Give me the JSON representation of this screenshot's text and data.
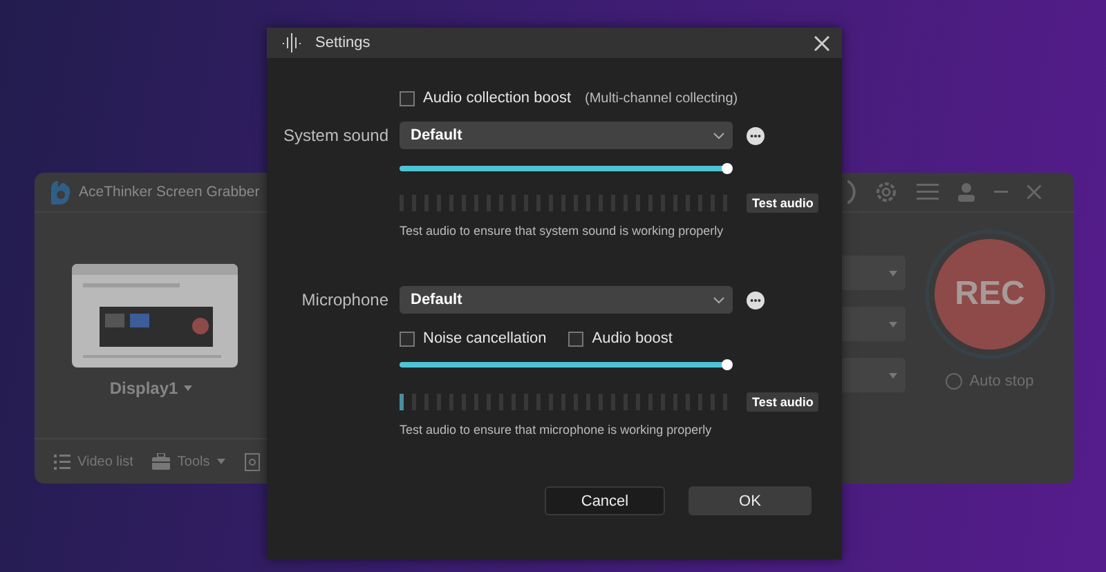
{
  "background_window": {
    "title": "AceThinker Screen Grabber",
    "display": {
      "label": "Display1"
    },
    "toolbar": [
      {
        "kind": "list",
        "label": "Video list"
      },
      {
        "kind": "tools",
        "label": "Tools"
      },
      {
        "kind": "screenshot"
      }
    ],
    "record": {
      "label": "REC"
    },
    "auto_stop": {
      "label": "Auto stop",
      "checked": false
    }
  },
  "dialog": {
    "title": "Settings",
    "audio_boost": {
      "label": "Audio collection boost",
      "note": "(Multi-channel collecting)",
      "checked": false
    },
    "sections": [
      {
        "label": "System sound",
        "device": "Default",
        "volume": {
          "level": 1
        },
        "meter": {
          "level": 0
        },
        "test_button": "Test audio",
        "hint": "Test audio to ensure that system sound is working properly"
      },
      {
        "label": "Microphone",
        "device": "Default",
        "options": [
          {
            "label": "Noise cancellation",
            "checked": false
          },
          {
            "label": "Audio boost",
            "checked": false
          }
        ],
        "volume": {
          "level": 1
        },
        "meter": {
          "level": 0.04
        },
        "test_button": "Test audio",
        "hint": "Test audio to ensure that microphone is working properly"
      }
    ],
    "buttons": [
      {
        "kind": "secondary",
        "label": "Cancel"
      },
      {
        "kind": "primary",
        "label": "OK"
      }
    ]
  }
}
